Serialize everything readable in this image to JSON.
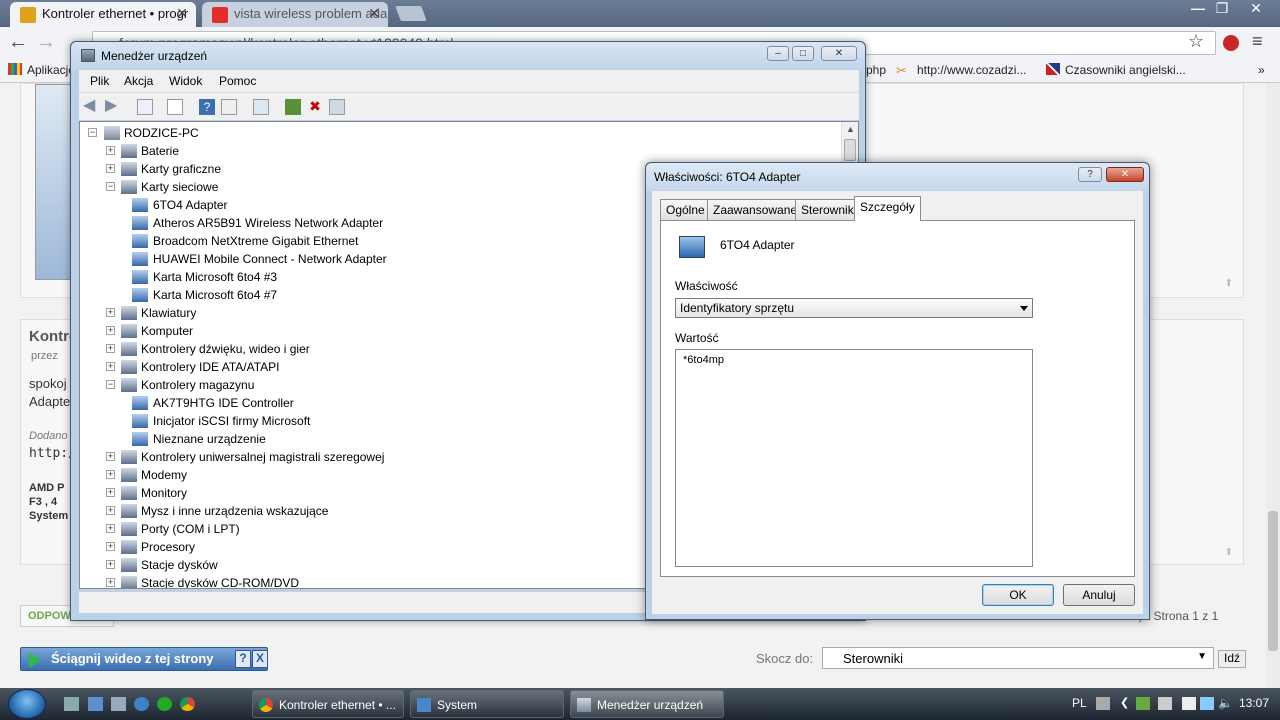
{
  "browser": {
    "tabs": [
      {
        "title": "Kontroler ethernet • progr",
        "active": true
      },
      {
        "title": "vista wireless problem ada",
        "active": false
      }
    ],
    "address": "forum.programosy.pl/kontroler-ethernet-vt139049.html",
    "bookmarks": [
      "Aplikacje",
      "php",
      "http://www.cozadzi...",
      "Czasowniki angielski..."
    ]
  },
  "webpage": {
    "post_title": "Kontro",
    "post_meta": "przez",
    "post_text": [
      "spokoj",
      "Adapte"
    ],
    "added_label": "Dodano",
    "link_prefix": "http:/",
    "spec_lines": [
      "AMD P",
      "F3 , 4",
      "System"
    ],
    "reply_label": "ODPOW",
    "pagination": "w) • Strona 1 z 1",
    "download_button": "Ściągnij wideo z tej strony",
    "download_help": "?",
    "download_close": "X",
    "jump_label": "Skocz do:",
    "jump_value": "Sterowniki",
    "jump_go": "Idź"
  },
  "device_manager": {
    "title": "Menedżer urządzeń",
    "menu": [
      "Plik",
      "Akcja",
      "Widok",
      "Pomoc"
    ],
    "tree": {
      "root": "RODZICE-PC",
      "categories": [
        {
          "label": "Baterie",
          "expanded": false
        },
        {
          "label": "Karty graficzne",
          "expanded": false
        },
        {
          "label": "Karty sieciowe",
          "expanded": true,
          "children": [
            "6TO4 Adapter",
            "Atheros AR5B91 Wireless Network Adapter",
            "Broadcom NetXtreme Gigabit Ethernet",
            "HUAWEI Mobile Connect - Network Adapter",
            "Karta Microsoft 6to4 #3",
            "Karta Microsoft 6to4 #7"
          ]
        },
        {
          "label": "Klawiatury",
          "expanded": false
        },
        {
          "label": "Komputer",
          "expanded": false
        },
        {
          "label": "Kontrolery dźwięku, wideo i gier",
          "expanded": false
        },
        {
          "label": "Kontrolery IDE ATA/ATAPI",
          "expanded": false
        },
        {
          "label": "Kontrolery magazynu",
          "expanded": true,
          "children": [
            "AK7T9HTG IDE Controller",
            "Inicjator iSCSI firmy Microsoft",
            "Nieznane urządzenie"
          ]
        },
        {
          "label": "Kontrolery uniwersalnej magistrali szeregowej",
          "expanded": false
        },
        {
          "label": "Modemy",
          "expanded": false
        },
        {
          "label": "Monitory",
          "expanded": false
        },
        {
          "label": "Mysz i inne urządzenia wskazujące",
          "expanded": false
        },
        {
          "label": "Porty (COM i LPT)",
          "expanded": false
        },
        {
          "label": "Procesory",
          "expanded": false
        },
        {
          "label": "Stacje dysków",
          "expanded": false
        },
        {
          "label": "Stacje dysków CD-ROM/DVD",
          "expanded": false
        }
      ]
    }
  },
  "properties": {
    "title": "Właściwości: 6TO4 Adapter",
    "help": "?",
    "tabs": [
      "Ogólne",
      "Zaawansowane",
      "Sterownik",
      "Szczegóły"
    ],
    "selected_tab": "Szczegóły",
    "device_name": "6TO4 Adapter",
    "property_label": "Właściwość",
    "property_value": "Identyfikatory sprzętu",
    "value_label": "Wartość",
    "values": [
      "*6to4mp"
    ],
    "ok": "OK",
    "cancel": "Anuluj"
  },
  "taskbar": {
    "tasks": [
      {
        "label": "Kontroler ethernet • ...",
        "active": false
      },
      {
        "label": "System",
        "active": false
      },
      {
        "label": "Menedżer urządzeń",
        "active": true
      }
    ],
    "language": "PL",
    "clock": "13:07"
  }
}
